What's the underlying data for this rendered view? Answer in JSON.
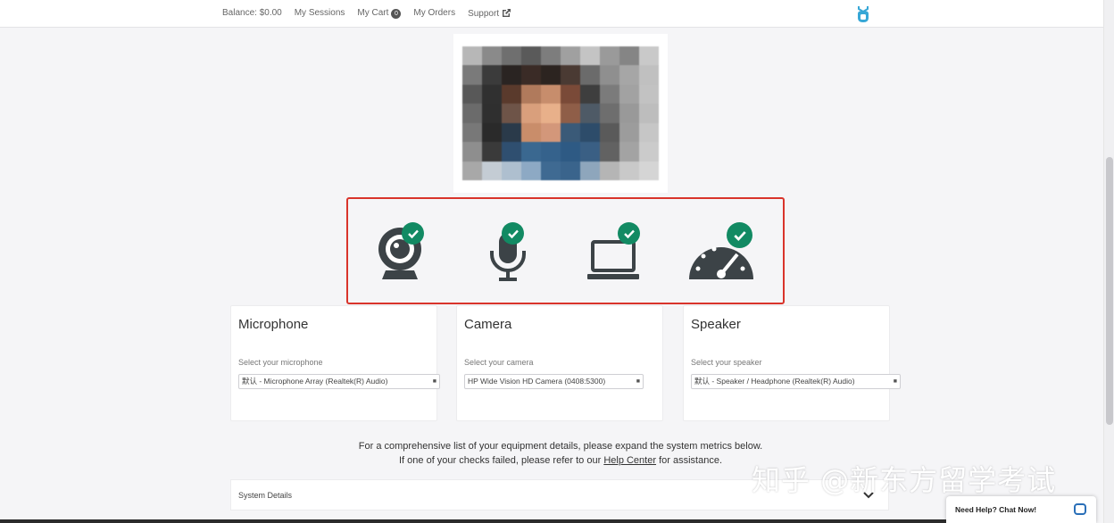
{
  "nav": {
    "balance": "Balance: $0.00",
    "sessions": "My Sessions",
    "cart": "My Cart",
    "cart_count": "0",
    "orders": "My Orders",
    "support": "Support"
  },
  "checks": [
    {
      "name": "webcam-icon",
      "status": "passed"
    },
    {
      "name": "microphone-icon",
      "status": "passed"
    },
    {
      "name": "laptop-icon",
      "status": "passed"
    },
    {
      "name": "speedometer-icon",
      "status": "passed"
    }
  ],
  "devices": {
    "microphone": {
      "title": "Microphone",
      "label": "Select your microphone",
      "value": "默认 - Microphone Array (Realtek(R) Audio)"
    },
    "camera": {
      "title": "Camera",
      "label": "Select your camera",
      "value": "HP Wide Vision HD Camera (0408:5300)"
    },
    "speaker": {
      "title": "Speaker",
      "label": "Select your speaker",
      "value": "默认 - Speaker / Headphone (Realtek(R) Audio)"
    }
  },
  "info": {
    "line1": "For a comprehensive list of your equipment details, please expand the system metrics below.",
    "line2_pre": "If one of your checks failed, please refer to our",
    "help_link": "Help Center",
    "line2_post": "for assistance."
  },
  "system_details": {
    "label": "System Details"
  },
  "watermark": "知乎 @新东方留学考试",
  "chat": {
    "label": "Need Help? Chat Now!"
  },
  "colors": {
    "check_green": "#128a63",
    "highlight_red": "#d9342b",
    "icon_dark": "#3c4347"
  }
}
